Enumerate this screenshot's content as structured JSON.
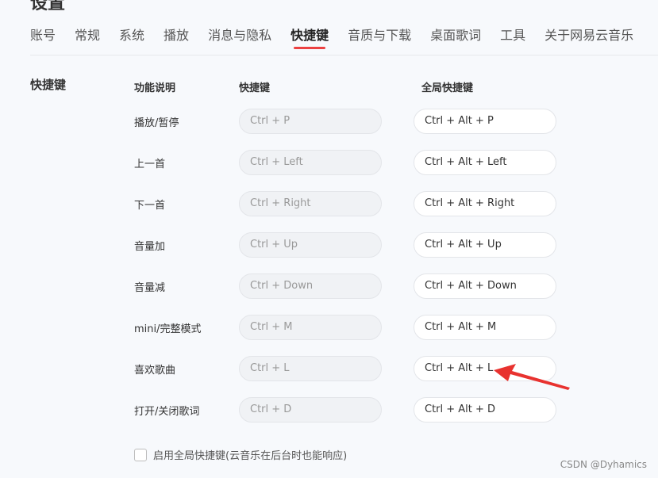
{
  "header": {
    "title": "设置"
  },
  "tabs": [
    {
      "label": "账号"
    },
    {
      "label": "常规"
    },
    {
      "label": "系统"
    },
    {
      "label": "播放"
    },
    {
      "label": "消息与隐私"
    },
    {
      "label": "快捷键",
      "active": true
    },
    {
      "label": "音质与下载"
    },
    {
      "label": "桌面歌词"
    },
    {
      "label": "工具"
    },
    {
      "label": "关于网易云音乐"
    }
  ],
  "section": {
    "title": "快捷键",
    "col_function": "功能说明",
    "col_shortcut": "快捷键",
    "col_global": "全局快捷键"
  },
  "shortcuts": [
    {
      "label": "播放/暂停",
      "local": "Ctrl + P",
      "global": "Ctrl + Alt + P"
    },
    {
      "label": "上一首",
      "local": "Ctrl + Left",
      "global": "Ctrl + Alt + Left"
    },
    {
      "label": "下一首",
      "local": "Ctrl + Right",
      "global": "Ctrl + Alt + Right"
    },
    {
      "label": "音量加",
      "local": "Ctrl + Up",
      "global": "Ctrl + Alt + Up"
    },
    {
      "label": "音量减",
      "local": "Ctrl + Down",
      "global": "Ctrl + Alt + Down"
    },
    {
      "label": "mini/完整模式",
      "local": "Ctrl + M",
      "global": "Ctrl + Alt + M"
    },
    {
      "label": "喜欢歌曲",
      "local": "Ctrl + L",
      "global": "Ctrl + Alt + L"
    },
    {
      "label": "打开/关闭歌词",
      "local": "Ctrl + D",
      "global": "Ctrl + Alt + D"
    }
  ],
  "global_toggle": {
    "label": "启用全局快捷键(云音乐在后台时也能响应)",
    "checked": false
  },
  "watermark": "CSDN @Dyhamics",
  "colors": {
    "accent": "#ec4141",
    "annotation_arrow": "#e8322f"
  }
}
